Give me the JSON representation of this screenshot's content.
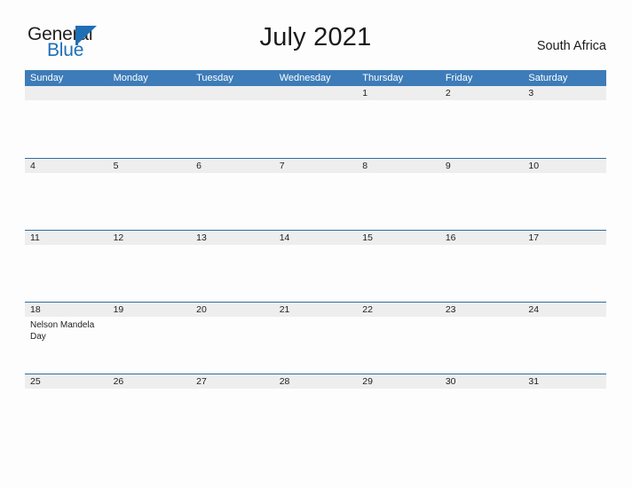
{
  "brand": {
    "name_part1": "General",
    "name_part2": "Blue",
    "mark": "triangle-logo-mark",
    "accent_color": "#1f6fb5"
  },
  "header": {
    "title": "July 2021",
    "region": "South Africa"
  },
  "theme": {
    "header_bar_color": "#3d7cb8",
    "rule_color": "#2e6da4",
    "day_band_color": "#eeeeee",
    "page_background": "#fdfdfd",
    "text_color": "#1e1e1e"
  },
  "calendar": {
    "month": "July",
    "year": "2021",
    "weekday_headers": [
      "Sunday",
      "Monday",
      "Tuesday",
      "Wednesday",
      "Thursday",
      "Friday",
      "Saturday"
    ],
    "weeks": [
      [
        {
          "day": "",
          "events": []
        },
        {
          "day": "",
          "events": []
        },
        {
          "day": "",
          "events": []
        },
        {
          "day": "",
          "events": []
        },
        {
          "day": "1",
          "events": []
        },
        {
          "day": "2",
          "events": []
        },
        {
          "day": "3",
          "events": []
        }
      ],
      [
        {
          "day": "4",
          "events": []
        },
        {
          "day": "5",
          "events": []
        },
        {
          "day": "6",
          "events": []
        },
        {
          "day": "7",
          "events": []
        },
        {
          "day": "8",
          "events": []
        },
        {
          "day": "9",
          "events": []
        },
        {
          "day": "10",
          "events": []
        }
      ],
      [
        {
          "day": "11",
          "events": []
        },
        {
          "day": "12",
          "events": []
        },
        {
          "day": "13",
          "events": []
        },
        {
          "day": "14",
          "events": []
        },
        {
          "day": "15",
          "events": []
        },
        {
          "day": "16",
          "events": []
        },
        {
          "day": "17",
          "events": []
        }
      ],
      [
        {
          "day": "18",
          "events": [
            "Nelson Mandela Day"
          ]
        },
        {
          "day": "19",
          "events": []
        },
        {
          "day": "20",
          "events": []
        },
        {
          "day": "21",
          "events": []
        },
        {
          "day": "22",
          "events": []
        },
        {
          "day": "23",
          "events": []
        },
        {
          "day": "24",
          "events": []
        }
      ],
      [
        {
          "day": "25",
          "events": []
        },
        {
          "day": "26",
          "events": []
        },
        {
          "day": "27",
          "events": []
        },
        {
          "day": "28",
          "events": []
        },
        {
          "day": "29",
          "events": []
        },
        {
          "day": "30",
          "events": []
        },
        {
          "day": "31",
          "events": []
        }
      ]
    ]
  }
}
